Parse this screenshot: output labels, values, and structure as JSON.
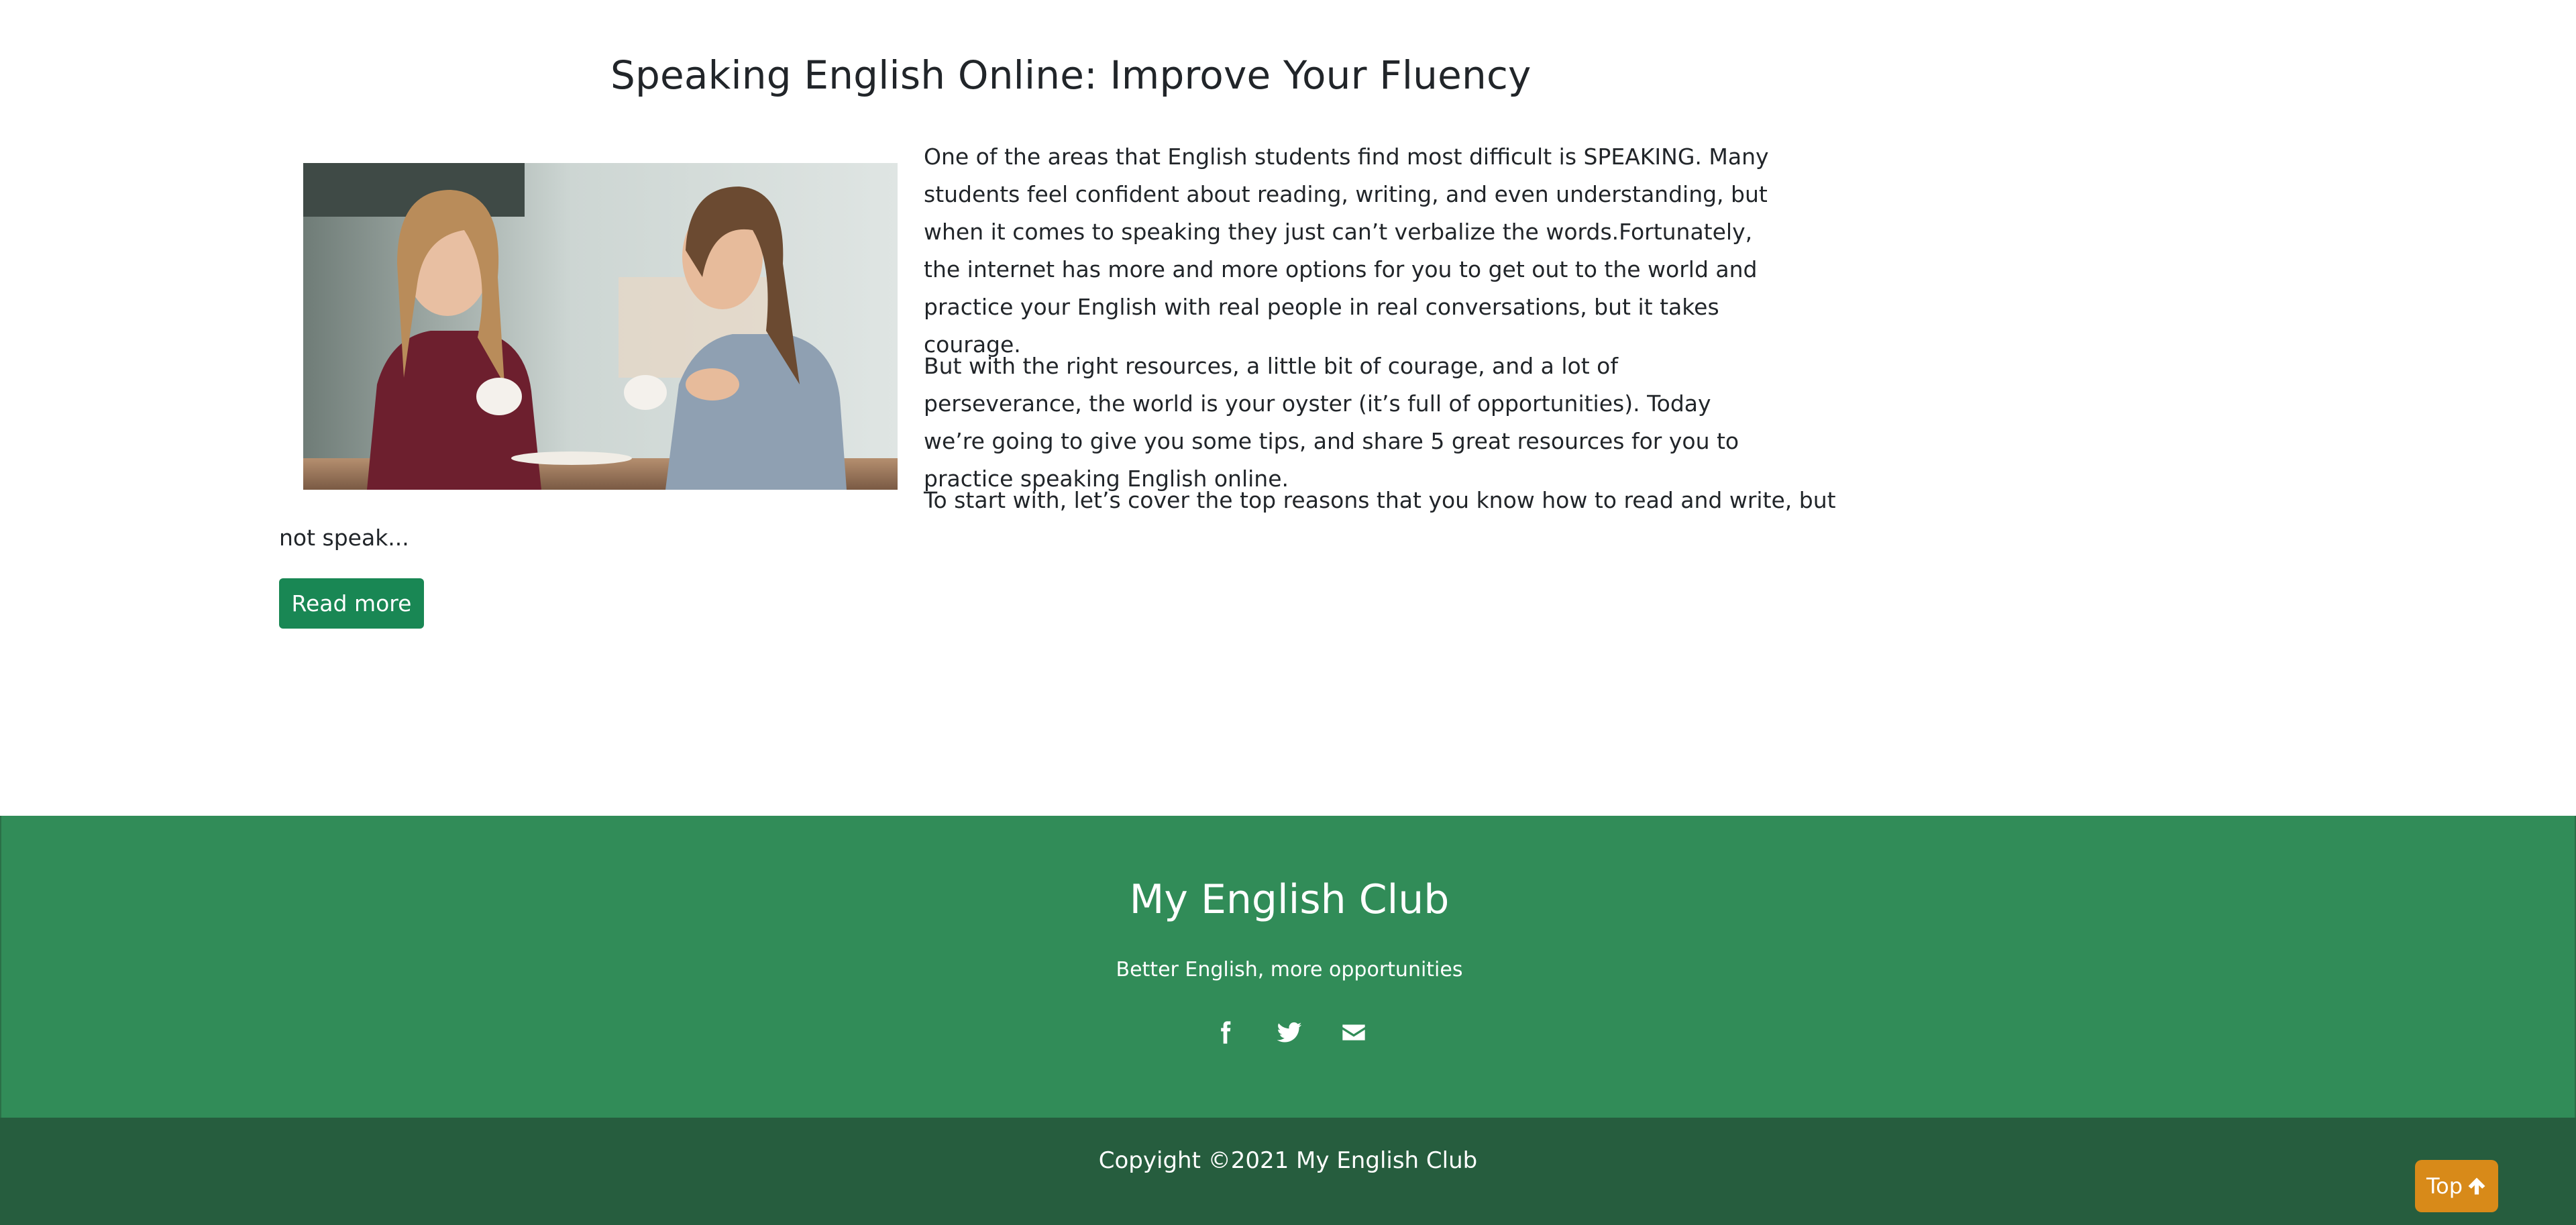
{
  "article": {
    "title": "Speaking English Online: Improve Your Fluency",
    "paragraphs": [
      "One of the areas that English students find most difficult is SPEAKING. Many students feel confident about reading, writing, and even understanding, but when it comes to speaking they just can’t verbalize the words.Fortunately, the internet has more and more options for you to get out to the world and practice your English with real people in real conversations, but it takes courage.",
      "But with the right resources, a little bit of courage, and a lot of perseverance, the world is your oyster (it’s full of opportunities). Today we’re going to give you some tips, and share 5 great resources for you to practice speaking English online."
    ],
    "excerpt_line_1": "To start with, let’s cover the top reasons that you know how to read and write, but",
    "excerpt_line_2": "not speak...",
    "read_more_label": "Read more"
  },
  "footer": {
    "title": "My English Club",
    "tagline": "Better English, more opportunities",
    "social_icons": [
      "facebook-icon",
      "twitter-icon",
      "envelope-icon"
    ],
    "copyright": "Copyight ©2021 My English Club"
  },
  "top_button": {
    "label": "Top",
    "icon": "arrow-up-icon"
  },
  "colors": {
    "accent_green": "#198754",
    "footer_green": "#318c58",
    "footer_dark": "#265d3e",
    "top_button": "#d88a19"
  }
}
